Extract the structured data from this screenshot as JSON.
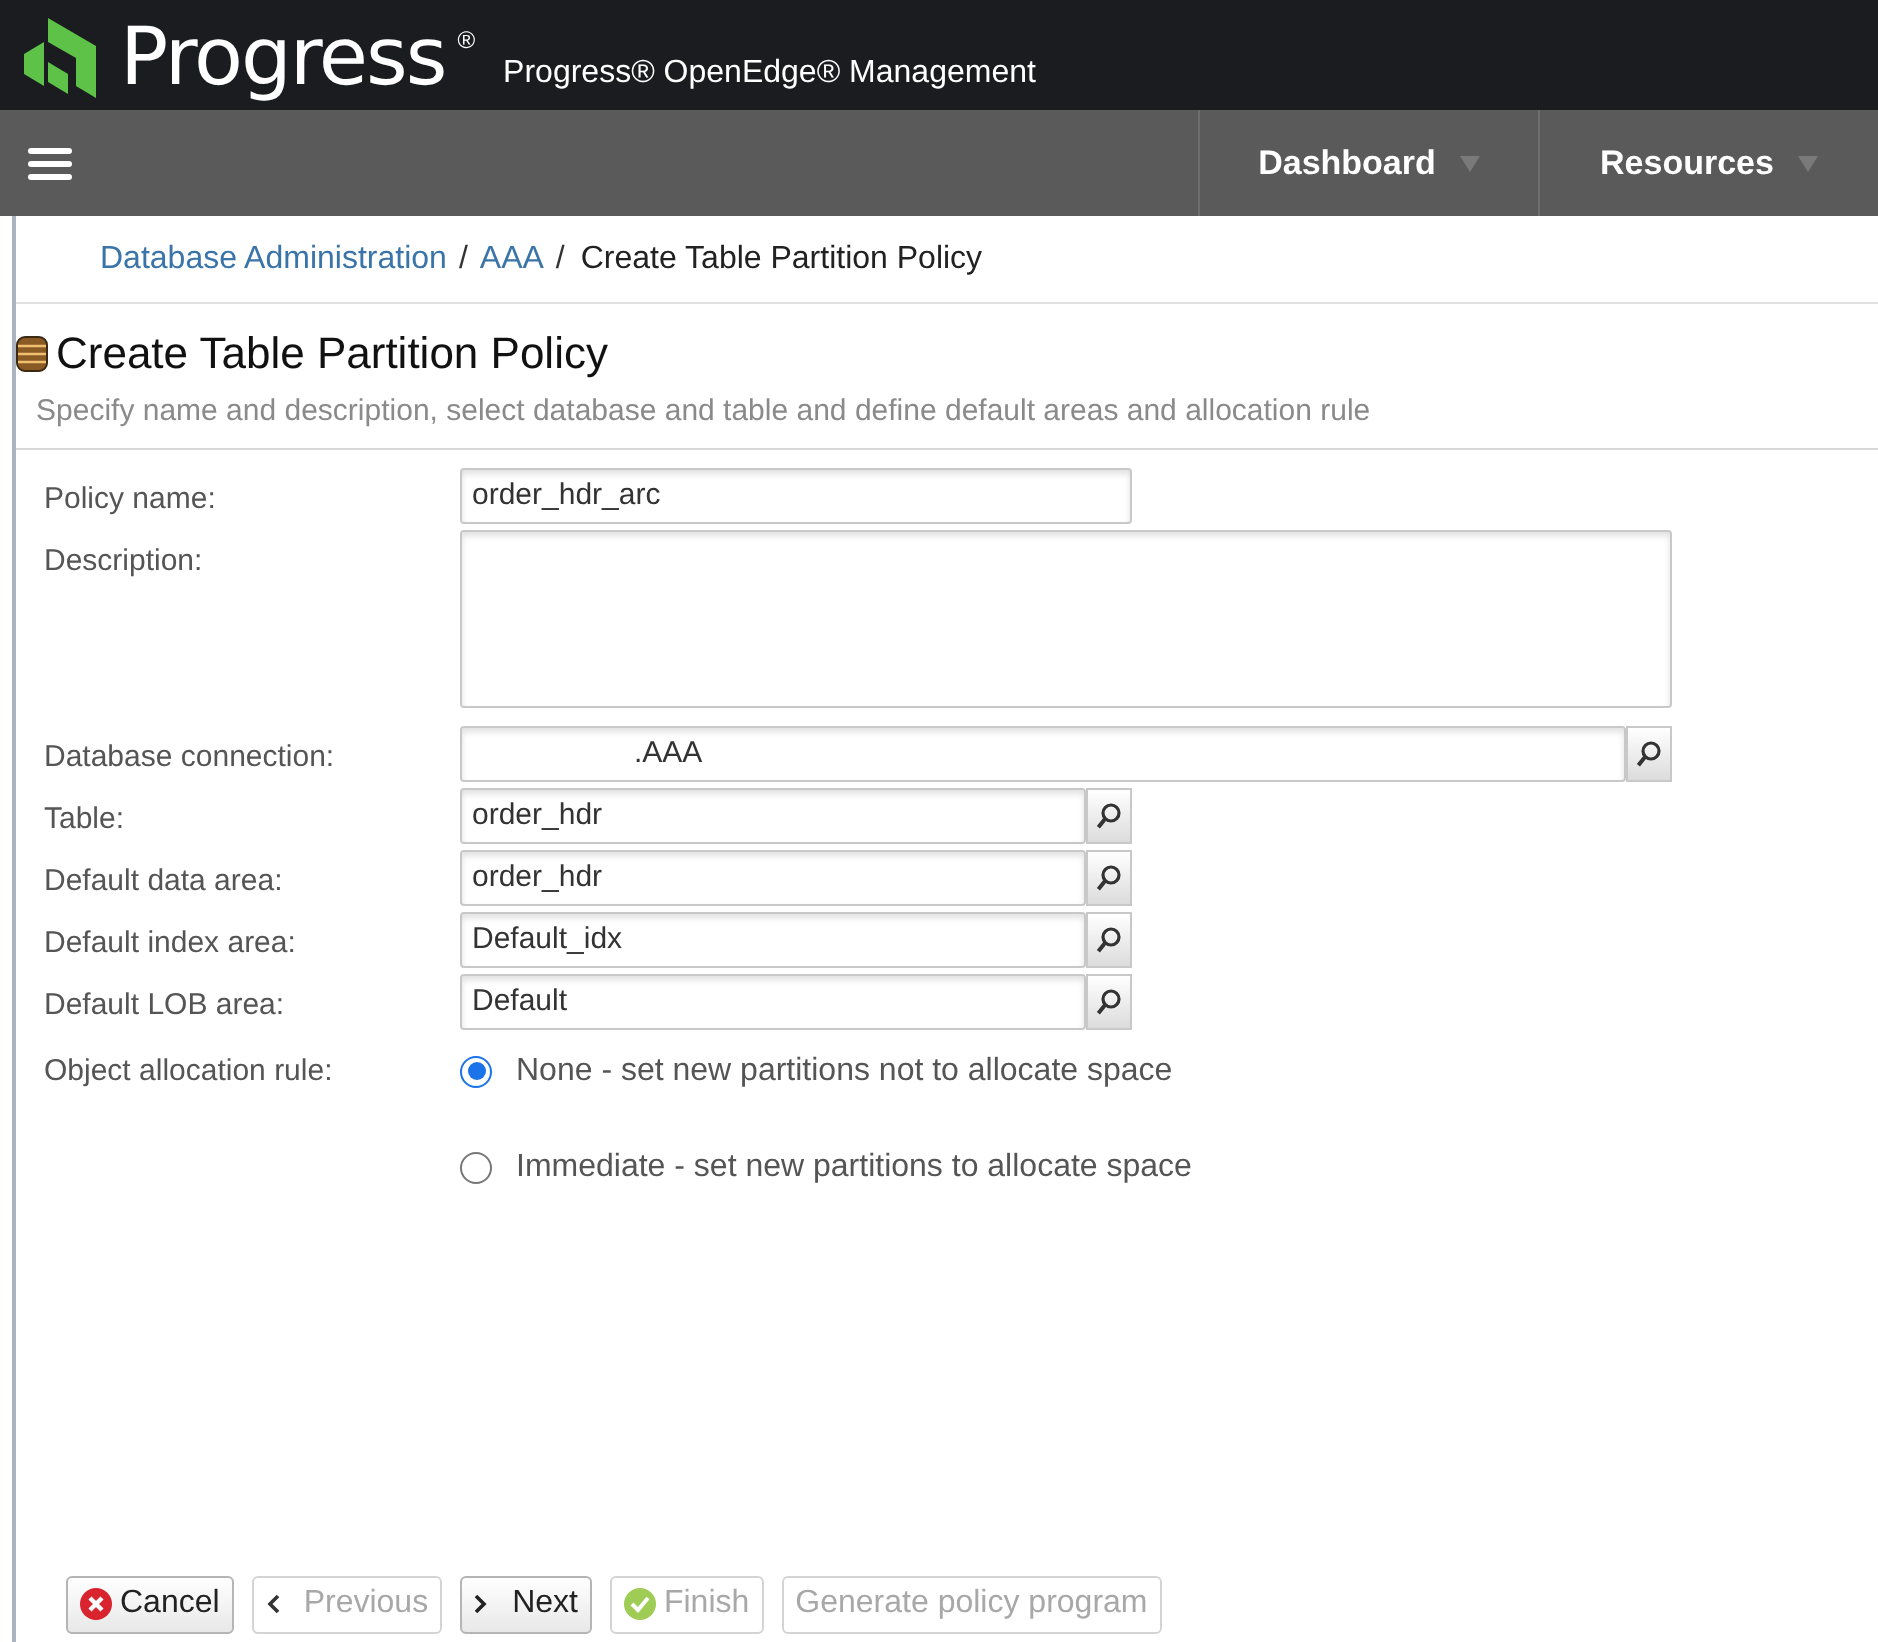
{
  "header": {
    "brand": "Progress",
    "registered_mark": "®",
    "product": "Progress® OpenEdge® Management"
  },
  "nav": {
    "menu": [
      {
        "label": "Dashboard"
      },
      {
        "label": "Resources"
      }
    ]
  },
  "breadcrumb_separator": "/",
  "breadcrumb": [
    {
      "label": "Database Administration",
      "kind": "link"
    },
    {
      "label": "AAA",
      "kind": "link"
    },
    {
      "label": "Create Table Partition Policy",
      "kind": "current"
    }
  ],
  "page": {
    "title": "Create Table Partition Policy",
    "subtitle": "Specify name and description, select database and table and define default areas and allocation rule"
  },
  "form": {
    "fields": [
      {
        "label": "Policy name:",
        "value": "order_hdr_arc",
        "kind": "text"
      },
      {
        "label": "Description:",
        "kind": "textarea"
      },
      {
        "label": "Database connection:",
        "value": ".AAA",
        "kind": "lookup_wide"
      },
      {
        "label": "Table:",
        "value": "order_hdr",
        "kind": "lookup"
      },
      {
        "label": "Default data area:",
        "value": "order_hdr",
        "kind": "lookup"
      },
      {
        "label": "Default index area:",
        "value": "Default_idx",
        "kind": "lookup"
      },
      {
        "label": "Default LOB area:",
        "value": "Default",
        "kind": "lookup"
      }
    ],
    "allocation": {
      "label": "Object allocation rule:",
      "options": [
        {
          "label": "None - set new partitions not to allocate space",
          "selected": true
        },
        {
          "label": "Immediate - set new partitions to allocate space",
          "selected": false
        }
      ]
    }
  },
  "buttons": [
    {
      "label": "Cancel",
      "kind": "cancel",
      "disabled": false
    },
    {
      "label": "Previous",
      "kind": "previous",
      "disabled": true
    },
    {
      "label": "Next",
      "kind": "next",
      "disabled": false
    },
    {
      "label": "Finish",
      "kind": "finish",
      "disabled": true
    },
    {
      "label": "Generate policy program",
      "kind": "plain",
      "disabled": true
    }
  ]
}
